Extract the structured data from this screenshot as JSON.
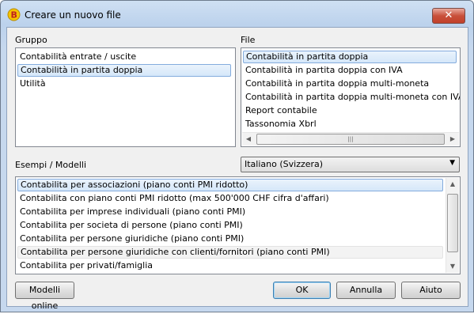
{
  "window": {
    "title": "Creare un nuovo file",
    "close_glyph": "✕",
    "app_icon": "banana-app-icon"
  },
  "group": {
    "label": "Gruppo",
    "items": [
      "Contabilità entrate / uscite",
      "Contabilità in partita doppia",
      "Utilità"
    ],
    "selected_index": 1
  },
  "file": {
    "label": "File",
    "items": [
      "Contabilità in partita doppia",
      "Contabilità in partita doppia con IVA",
      "Contabilità in partita doppia multi-moneta",
      "Contabilità in partita doppia multi-moneta con IVA",
      "Report contabile",
      "Tassonomia Xbrl"
    ],
    "selected_index": 0
  },
  "examples": {
    "label": "Esempi / Modelli",
    "language": "Italiano (Svizzera)",
    "items": [
      "Contabilita per associazioni (piano conti PMI ridotto)",
      "Contabilita con piano conti PMI ridotto (max 500'000 CHF cifra d'affari)",
      "Contabilita per imprese individuali (piano conti PMI)",
      "Contabilita per societa di persone (piano conti PMI)",
      "Contabilita per persone giuridiche (piano conti PMI)",
      "Contabilita per persone giuridiche con clienti/fornitori (piano conti PMI)",
      "Contabilita per privati/famiglia"
    ],
    "selected_index": 0,
    "hover_index": 5
  },
  "buttons": {
    "online": "Modelli online",
    "ok": "OK",
    "cancel": "Annulla",
    "help": "Aiuto"
  },
  "scroll_glyphs": {
    "left": "◀",
    "right": "▶",
    "up": "▲",
    "down": "▼",
    "grip": "|||"
  }
}
